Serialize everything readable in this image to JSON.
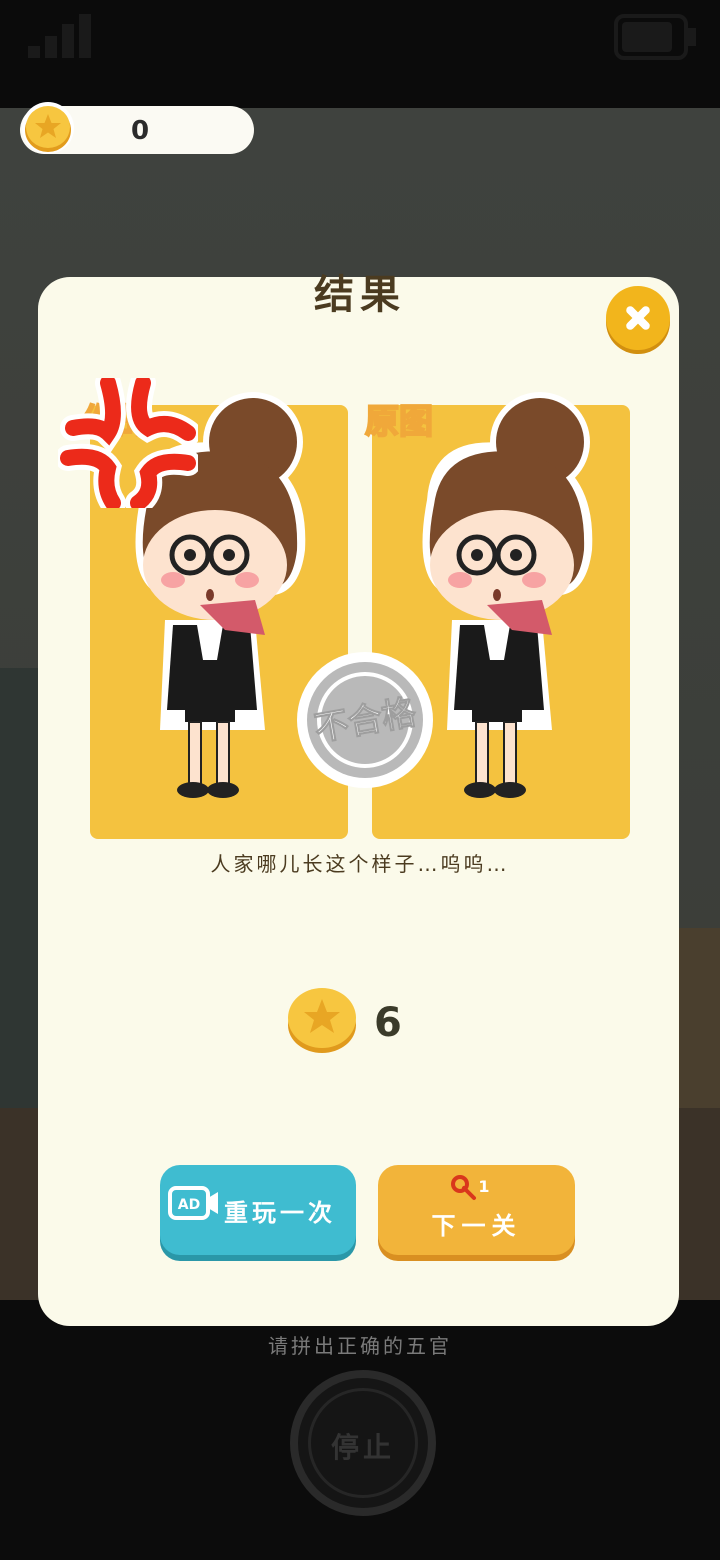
{
  "coins": {
    "value": "0"
  },
  "result": {
    "title": "结果",
    "label_left": "你的",
    "label_right": "原图",
    "stamp_text": "不合格",
    "caption": "人家哪儿长这个样子…呜呜…",
    "reward": "6",
    "replay_label": "重玩一次",
    "ad_label": "AD",
    "next_label": "下一关",
    "key_count": "1"
  },
  "hint": "请拼出正确的五官",
  "stop_label": "停止",
  "colors": {
    "panel": "#fbfaea",
    "card": "#f4c23f",
    "replay": "#3fbcd0",
    "next": "#f2b43a",
    "close": "#f2b51c"
  }
}
